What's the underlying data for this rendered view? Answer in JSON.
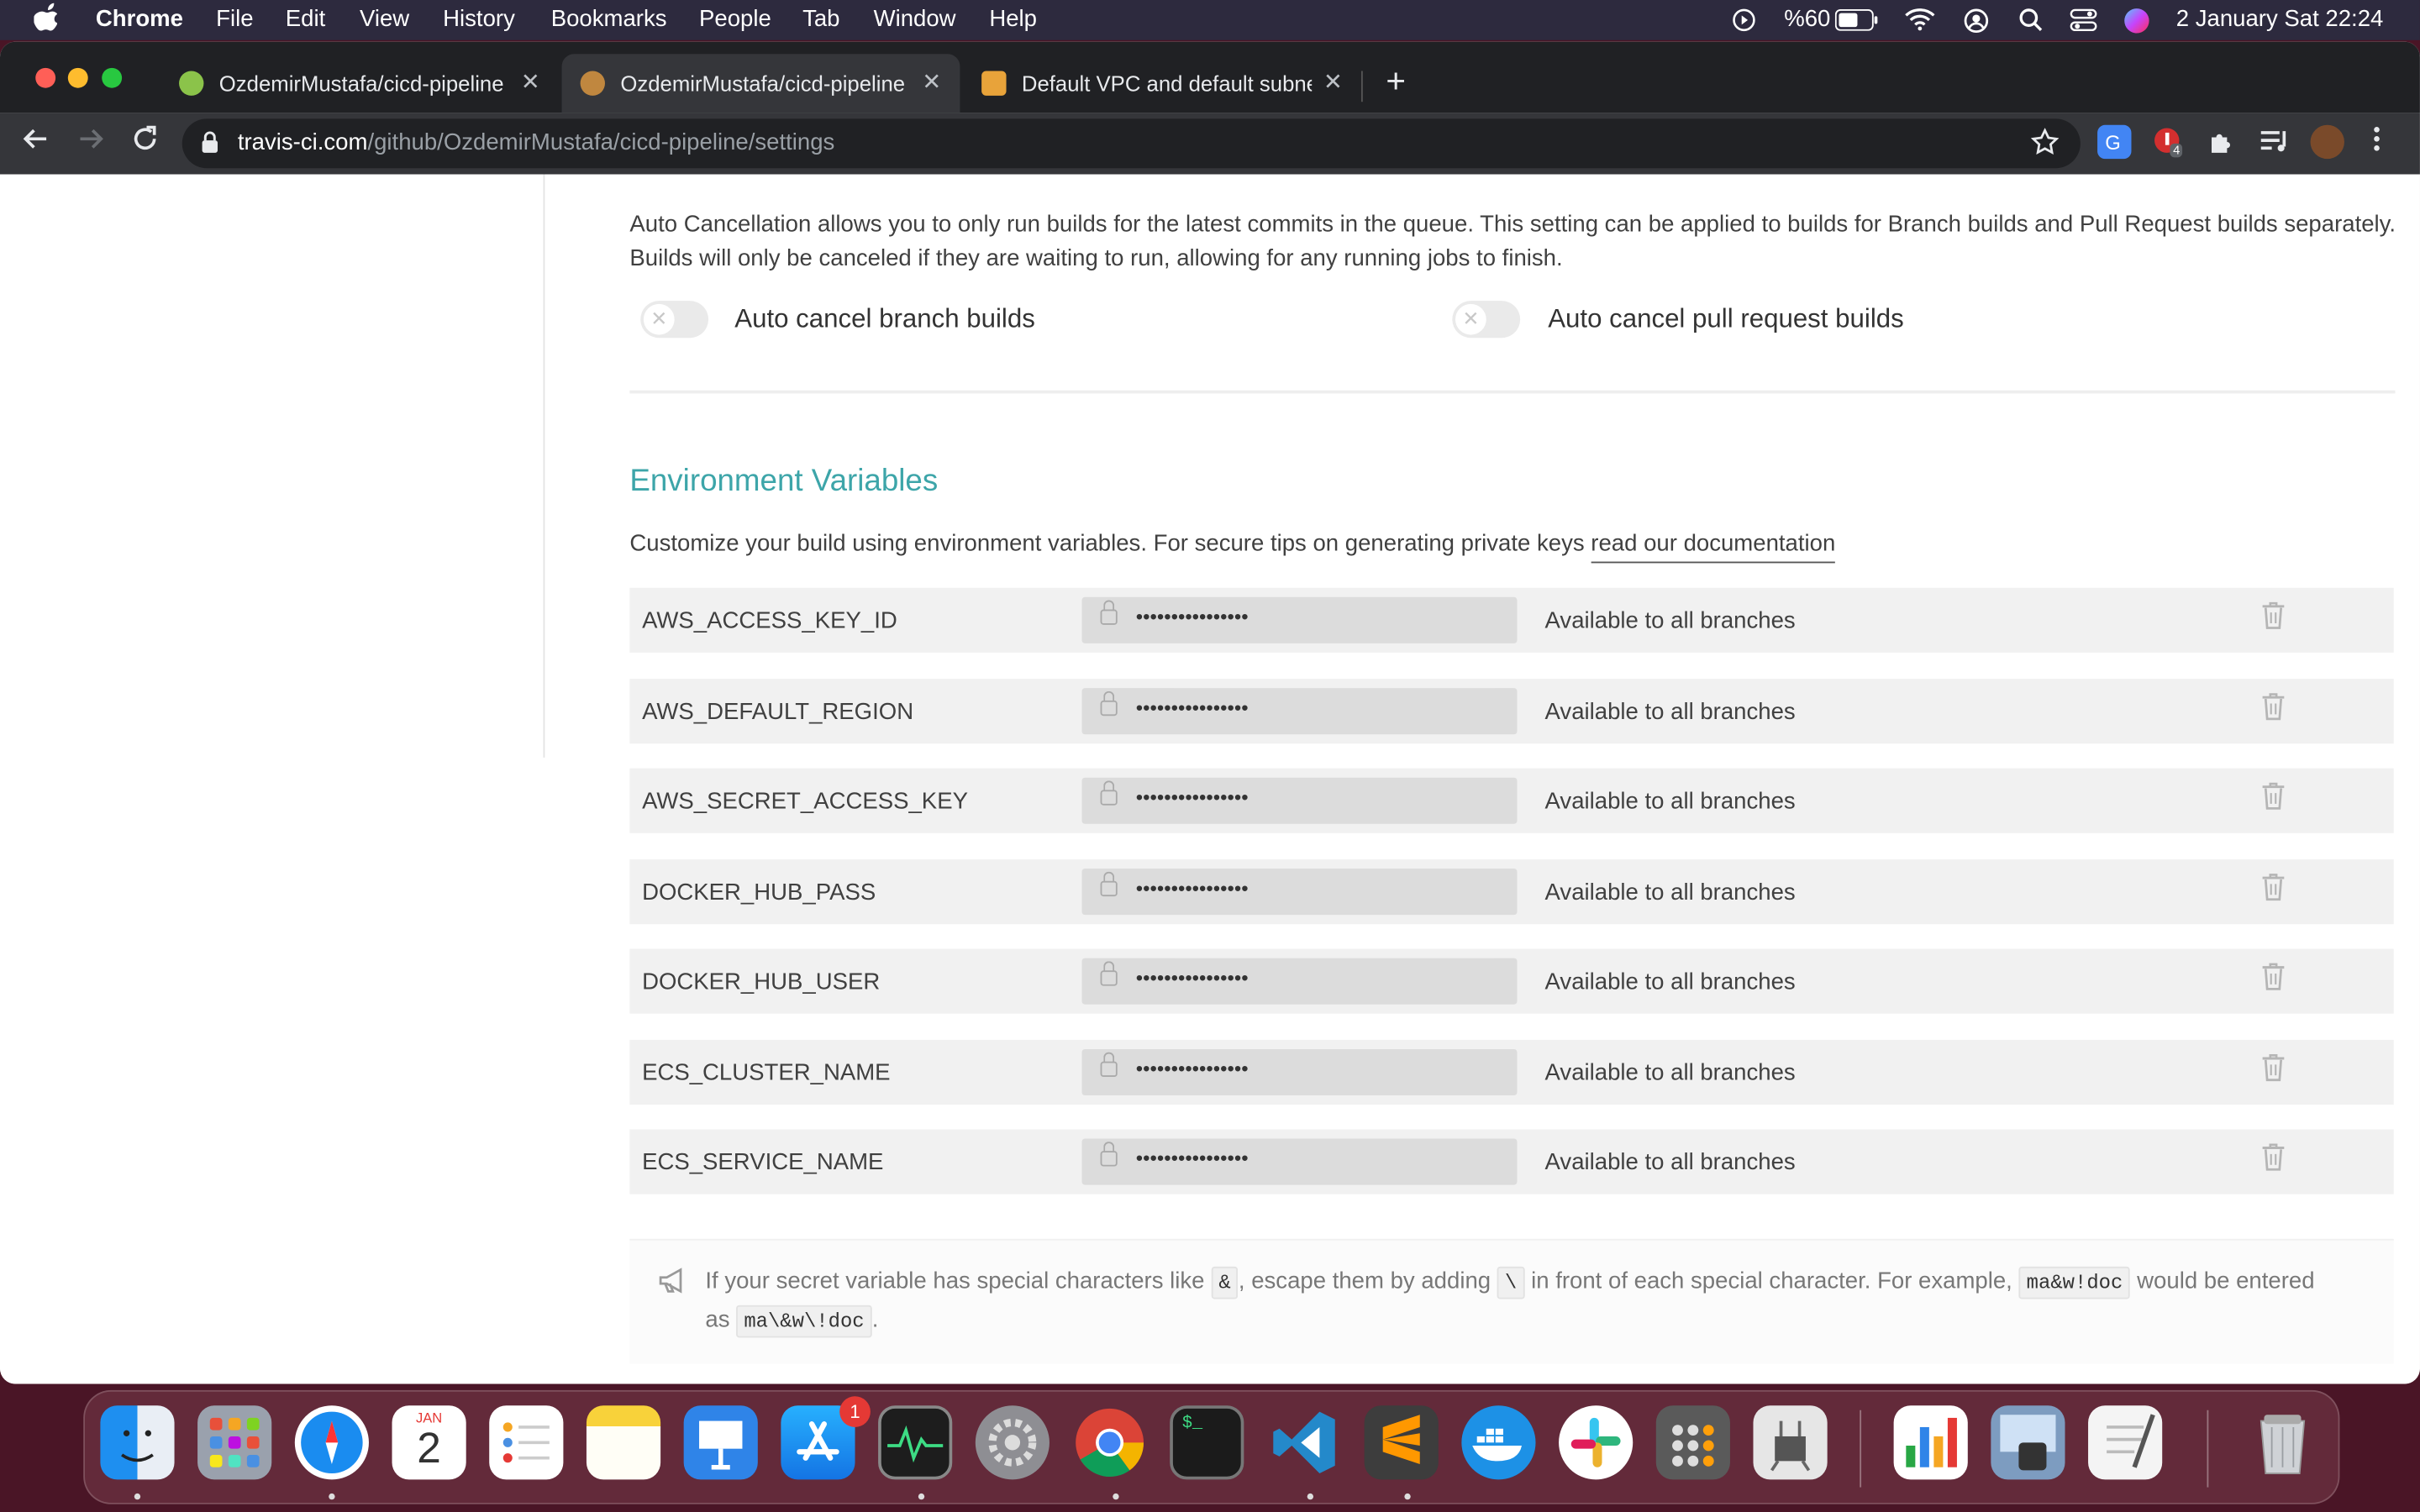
{
  "menubar": {
    "app": "Chrome",
    "items": [
      "File",
      "Edit",
      "View",
      "History",
      "Bookmarks",
      "People",
      "Tab",
      "Window",
      "Help"
    ],
    "battery": "%60",
    "datetime": "2 January Sat  22:24"
  },
  "tabs": [
    {
      "title": "OzdemirMustafa/cicd-pipeline",
      "close": "✕"
    },
    {
      "title": "OzdemirMustafa/cicd-pipeline",
      "close": "✕"
    },
    {
      "title": "Default VPC and default subne",
      "close": "✕"
    }
  ],
  "new_tab": "+",
  "address": {
    "host": "travis-ci.com",
    "path": "/github/OzdemirMustafa/cicd-pipeline/settings"
  },
  "ext_badge": "4",
  "auto_cancel": {
    "description": "Auto Cancellation allows you to only run builds for the latest commits in the queue. This setting can be applied to builds for Branch builds and Pull Request builds separately. Builds will only be canceled if they are waiting to run, allowing for any running jobs to finish.",
    "branch_label": "Auto cancel branch builds",
    "pr_label": "Auto cancel pull request builds",
    "branch_enabled": false,
    "pr_enabled": false
  },
  "env": {
    "title": "Environment Variables",
    "desc": "Customize your build using environment variables. For secure tips on generating private keys ",
    "link": "read our documentation",
    "rows": [
      {
        "name": "AWS_ACCESS_KEY_ID",
        "value": "••••••••••••••••",
        "branch": "Available to all branches"
      },
      {
        "name": "AWS_DEFAULT_REGION",
        "value": "••••••••••••••••",
        "branch": "Available to all branches"
      },
      {
        "name": "AWS_SECRET_ACCESS_KEY",
        "value": "••••••••••••••••",
        "branch": "Available to all branches"
      },
      {
        "name": "DOCKER_HUB_PASS",
        "value": "••••••••••••••••",
        "branch": "Available to all branches"
      },
      {
        "name": "DOCKER_HUB_USER",
        "value": "••••••••••••••••",
        "branch": "Available to all branches"
      },
      {
        "name": "ECS_CLUSTER_NAME",
        "value": "••••••••••••••••",
        "branch": "Available to all branches"
      },
      {
        "name": "ECS_SERVICE_NAME",
        "value": "••••••••••••••••",
        "branch": "Available to all branches"
      }
    ]
  },
  "note": {
    "p1": "If your secret variable has special characters like ",
    "c1": "&",
    "p2": ", escape them by adding ",
    "c2": "\\",
    "p3": " in front of each special character. For example, ",
    "c3": "ma&w!doc",
    "p4": " would be entered as ",
    "c4": "ma\\&w\\!doc",
    "p5": "."
  },
  "dock": {
    "calendar_month": "JAN",
    "calendar_day": "2",
    "appstore_badge": "1",
    "terminal_text": "$_"
  },
  "colors": {
    "accent": "#3da5a9",
    "menubar": "#2d2a3e",
    "tabstrip": "#202124",
    "toolbar": "#35363a"
  }
}
